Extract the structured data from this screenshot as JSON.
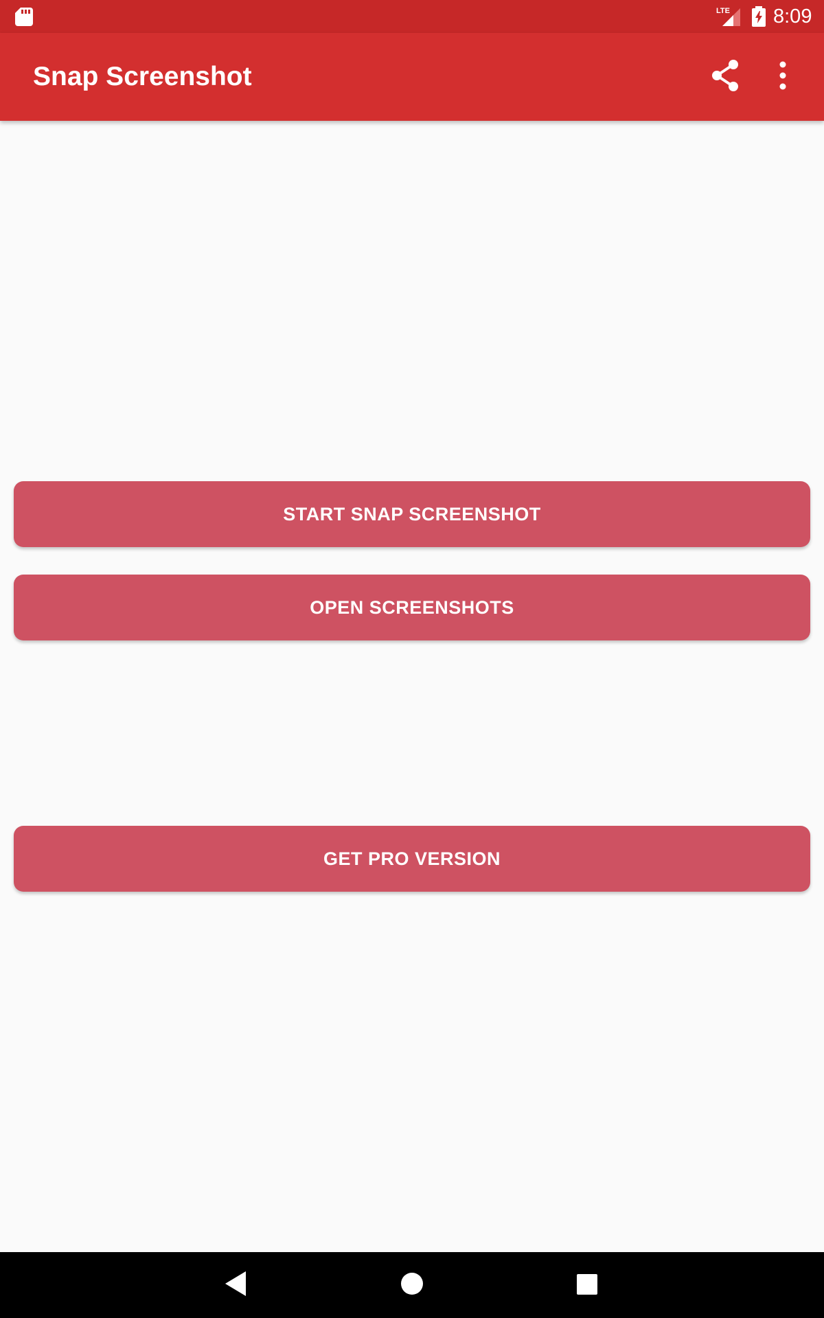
{
  "status_bar": {
    "time": "8:09",
    "network": "LTE",
    "icons": [
      "sd-card-icon",
      "lte-signal-icon",
      "battery-charging-icon"
    ]
  },
  "app_bar": {
    "title": "Snap Screenshot",
    "actions": [
      "share-icon",
      "more-vert-icon"
    ]
  },
  "buttons": {
    "start": "START SNAP SCREENSHOT",
    "open": "OPEN SCREENSHOTS",
    "pro": "GET PRO VERSION"
  },
  "nav_bar": {
    "icons": [
      "back-icon",
      "home-icon",
      "recents-icon"
    ]
  },
  "colors": {
    "status_bar": "#c62828",
    "app_bar": "#d32f2f",
    "button": "#ce5262",
    "background": "#fafafa"
  }
}
